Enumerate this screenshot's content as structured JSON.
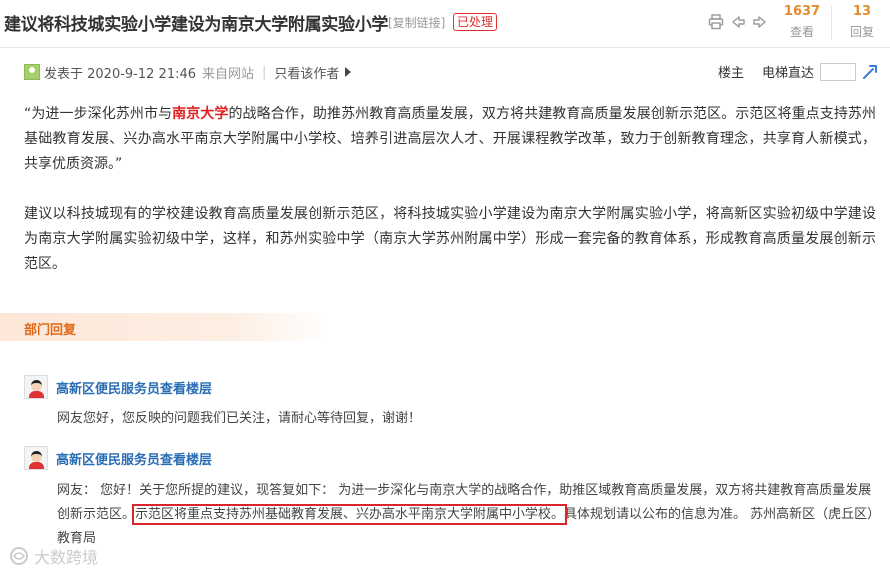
{
  "header": {
    "title": "建议将科技城实验小学建设为南京大学附属实验小学",
    "copy_link": "[复制链接]",
    "status": "已处理",
    "views_count": "1637",
    "views_label": "查看",
    "replies_count": "13",
    "replies_label": "回复"
  },
  "post": {
    "posted_at": "发表于 2020-9-12 21:46",
    "source": "来自网站",
    "author_only": "只看该作者",
    "owner_label": "楼主",
    "elevator_label": "电梯直达",
    "para1_before": "“为进一步深化苏州市与",
    "para1_highlight": "南京大学",
    "para1_after": "的战略合作，助推苏州教育高质量发展，双方将共建教育高质量发展创新示范区。示范区将重点支持苏州基础教育发展、兴办高水平南京大学附属中小学校、培养引进高层次人才、开展课程教学改革，致力于创新教育理念，共享育人新模式，共享优质资源。”",
    "para2": "建议以科技城现有的学校建设教育高质量发展创新示范区，将科技城实验小学建设为南京大学附属实验小学，将高新区实验初级中学建设为南京大学附属实验初级中学，这样，和苏州实验中学（南京大学苏州附属中学）形成一套完备的教育体系，形成教育高质量发展创新示范区。"
  },
  "department": {
    "banner": "部门回复",
    "replies": [
      {
        "author": "高新区便民服务员查看楼层",
        "text": "网友您好，您反映的问题我们已关注，请耐心等待回复，谢谢！"
      },
      {
        "author": "高新区便民服务员查看楼层",
        "text_before": "网友： 您好！关于您所提的建议，现答复如下： 为进一步深化与南京大学的战略合作，助推区域教育高质量发展，双方将共建教育高质量发展创新示范区。",
        "text_boxed": "示范区将重点支持苏州基础教育发展、兴办高水平南京大学附属中小学校。",
        "text_after": "具体规划请以公布的信息为准。 苏州高新区（虎丘区）教育局"
      }
    ]
  },
  "watermark": "大数跨境",
  "colors": {
    "accent_orange": "#e58b2c",
    "status_red": "#e03030",
    "link_blue": "#2a6db5",
    "highlight_box": "#d8262b"
  }
}
